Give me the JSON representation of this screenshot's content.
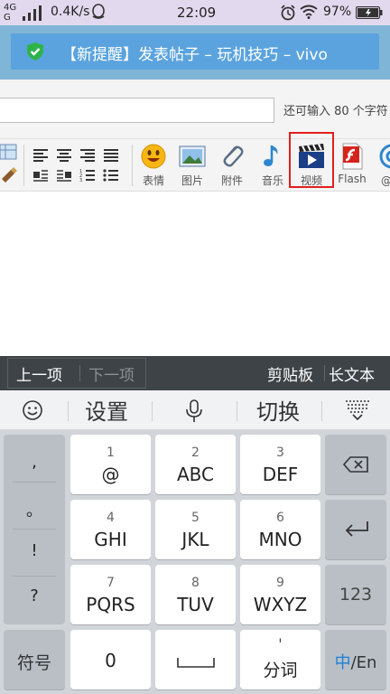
{
  "status_bar": {
    "network": "4G",
    "network2": "G",
    "speed": "0.4K/s",
    "time": "22:09",
    "battery": "97%"
  },
  "notification": {
    "title": "【新提醒】发表帖子 – 玩机技巧 – vivo"
  },
  "form": {
    "char_limit": "还可输入 80 个字符"
  },
  "toolbar": {
    "items": [
      {
        "label": "表情",
        "icon": "emoji-icon"
      },
      {
        "label": "图片",
        "icon": "image-icon"
      },
      {
        "label": "附件",
        "icon": "paperclip-icon"
      },
      {
        "label": "音乐",
        "icon": "music-note-icon"
      },
      {
        "label": "视频",
        "icon": "video-clapper-icon"
      },
      {
        "label": "Flash",
        "icon": "flash-icon"
      },
      {
        "label": "@朋",
        "icon": "at-icon"
      }
    ],
    "highlight_color": "#e0201d"
  },
  "keyboard": {
    "nav": {
      "prev": "上一项",
      "next": "下一项",
      "clipboard": "剪贴板",
      "long_text": "长文本"
    },
    "top": {
      "settings": "设置",
      "switch": "切换"
    },
    "punct": [
      ",",
      "。",
      "!",
      "?"
    ],
    "keys": [
      {
        "num": "1",
        "main": "@"
      },
      {
        "num": "2",
        "main": "ABC"
      },
      {
        "num": "3",
        "main": "DEF"
      },
      {
        "num": "4",
        "main": "GHI"
      },
      {
        "num": "5",
        "main": "JKL"
      },
      {
        "num": "6",
        "main": "MNO"
      },
      {
        "num": "7",
        "main": "PQRS"
      },
      {
        "num": "8",
        "main": "TUV"
      },
      {
        "num": "9",
        "main": "WXYZ"
      }
    ],
    "key_123": "123",
    "symbols": "符号",
    "zero": "0",
    "fenci_mark": "'",
    "fenci": "分词",
    "lang_zh": "中",
    "lang_rest": "/En",
    "lang_accent": "#1a7fd8"
  }
}
